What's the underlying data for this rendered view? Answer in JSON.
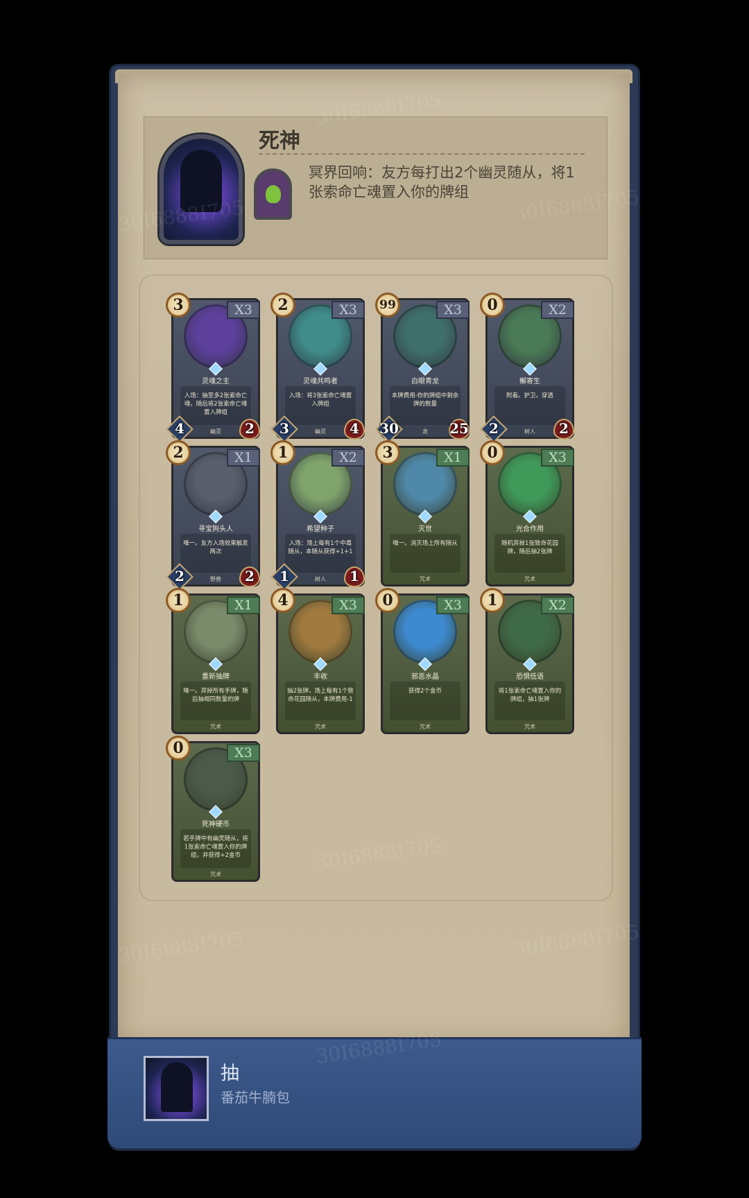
{
  "hero": {
    "name": "死神",
    "ability": "冥界回响：友方每打出2个幽灵随从，将1张索命亡魂置入你的牌组"
  },
  "cards": [
    {
      "cost": "3",
      "count": "X3",
      "name": "灵魂之主",
      "desc": "入场：抽至多2张索命亡魂，随后将2张索命亡魂置入牌组",
      "tribe": "幽灵",
      "attack": "4",
      "health": "2",
      "kind": "unit",
      "art": "#5d3f9c"
    },
    {
      "cost": "2",
      "count": "X3",
      "name": "灵魂共鸣者",
      "desc": "入场：将3张索命亡魂置入牌组",
      "tribe": "幽灵",
      "attack": "3",
      "health": "4",
      "kind": "unit",
      "art": "#3f8c8a"
    },
    {
      "cost": "99",
      "count": "X3",
      "name": "白眼青龙",
      "desc": "本牌费用-你的牌组中剩余牌的数量",
      "tribe": "龙",
      "attack": "30",
      "health": "25",
      "kind": "unit",
      "art": "#3f6f6a"
    },
    {
      "cost": "0",
      "count": "X2",
      "name": "檞寄生",
      "desc": "附着。护卫。穿透",
      "tribe": "树人",
      "attack": "2",
      "health": "2",
      "kind": "unit",
      "art": "#4a7a55"
    },
    {
      "cost": "2",
      "count": "X1",
      "name": "寻宝狗头人",
      "desc": "唯一。友方入场效果触发两次",
      "tribe": "野兽",
      "attack": "2",
      "health": "2",
      "kind": "unit",
      "art": "#5a5f6e"
    },
    {
      "cost": "1",
      "count": "X2",
      "name": "希望种子",
      "desc": "入场：场上每有1个中毒随从，本随从获得+1+1",
      "tribe": "树人",
      "attack": "1",
      "health": "1",
      "kind": "unit",
      "art": "#7fa36b"
    },
    {
      "cost": "3",
      "count": "X1",
      "name": "灭世",
      "desc": "唯一。消灭场上所有随从",
      "tribe": "咒术",
      "kind": "spell",
      "art": "#4f88a8"
    },
    {
      "cost": "0",
      "count": "X3",
      "name": "光合作用",
      "desc": "随机弃掉1张致命花园牌，随后抽2张牌",
      "tribe": "咒术",
      "kind": "spell",
      "art": "#3f9a5a"
    },
    {
      "cost": "1",
      "count": "X1",
      "name": "重新抽牌",
      "desc": "唯一。弃掉所有手牌，随后抽相同数量的牌",
      "tribe": "咒术",
      "kind": "spell",
      "art": "#7a8a6a"
    },
    {
      "cost": "4",
      "count": "X3",
      "name": "丰收",
      "desc": "抽2张牌，场上每有1个致命花园随从，本牌费用-1",
      "tribe": "咒术",
      "kind": "spell",
      "art": "#a07a3e"
    },
    {
      "cost": "0",
      "count": "X3",
      "name": "邪恶水晶",
      "desc": "获得2个金币",
      "tribe": "咒术",
      "kind": "spell",
      "art": "#3d8ad1"
    },
    {
      "cost": "1",
      "count": "X2",
      "name": "恐惧低语",
      "desc": "将1张索命亡魂置入你的牌组，抽1张牌",
      "tribe": "咒术",
      "kind": "spell",
      "art": "#3f6a47"
    },
    {
      "cost": "0",
      "count": "X3",
      "name": "死神硬币",
      "desc": "若手牌中有幽灵随从，将1张索命亡魂置入你的牌组，并获得+2金币",
      "tribe": "咒术",
      "kind": "spell",
      "art": "#4b5a4a"
    }
  ],
  "player": {
    "title": "抽",
    "subtitle": "番茄牛腩包"
  },
  "watermark": "30I6888I705",
  "colors": {
    "frame": "#2c3a55",
    "paper": "#c9bb9f",
    "unit_card": "#4a5264",
    "spell_card": "#4f5c3f",
    "count_blue": "#596078",
    "count_green": "#4d7c55",
    "bottom_bar": "#354f80"
  }
}
